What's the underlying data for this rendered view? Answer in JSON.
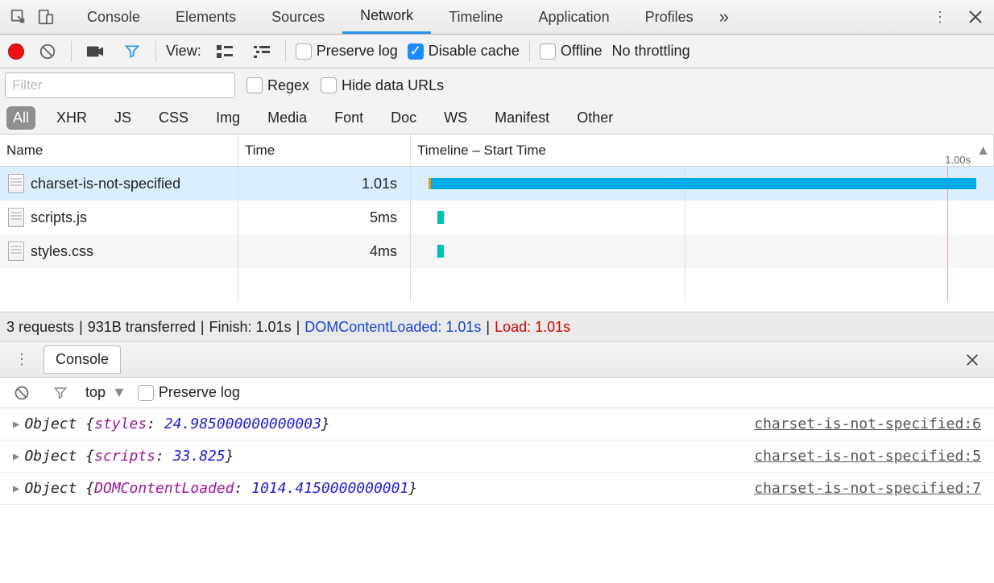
{
  "tabs": {
    "console": "Console",
    "elements": "Elements",
    "sources": "Sources",
    "network": "Network",
    "timeline": "Timeline",
    "application": "Application",
    "profiles": "Profiles"
  },
  "sub": {
    "view": "View:",
    "preserve_log": "Preserve log",
    "disable_cache": "Disable cache",
    "offline": "Offline",
    "throttle": "No throttling"
  },
  "filter": {
    "placeholder": "Filter",
    "regex": "Regex",
    "hide": "Hide data URLs"
  },
  "pills": {
    "all": "All",
    "xhr": "XHR",
    "js": "JS",
    "css": "CSS",
    "img": "Img",
    "media": "Media",
    "font": "Font",
    "doc": "Doc",
    "ws": "WS",
    "manifest": "Manifest",
    "other": "Other"
  },
  "headers": {
    "name": "Name",
    "time": "Time",
    "timeline": "Timeline – Start Time",
    "tick": "1.00s"
  },
  "rows": [
    {
      "name": "charset-is-not-specified",
      "time": "1.01s"
    },
    {
      "name": "scripts.js",
      "time": "5ms"
    },
    {
      "name": "styles.css",
      "time": "4ms"
    }
  ],
  "summary": {
    "requests": "3 requests",
    "transferred": "931B transferred",
    "finish": "Finish: 1.01s",
    "dcl": "DOMContentLoaded: 1.01s",
    "load": "Load: 1.01s"
  },
  "drawer": {
    "tab": "Console"
  },
  "console_toolbar": {
    "context": "top",
    "preserve": "Preserve log"
  },
  "console": [
    {
      "obj": "Object",
      "key": "styles",
      "val": "24.985000000000003",
      "src": "charset-is-not-specified:6"
    },
    {
      "obj": "Object",
      "key": "scripts",
      "val": "33.825",
      "src": "charset-is-not-specified:5"
    },
    {
      "obj": "Object",
      "key": "DOMContentLoaded",
      "val": "1014.4150000000001",
      "src": "charset-is-not-specified:7"
    }
  ]
}
